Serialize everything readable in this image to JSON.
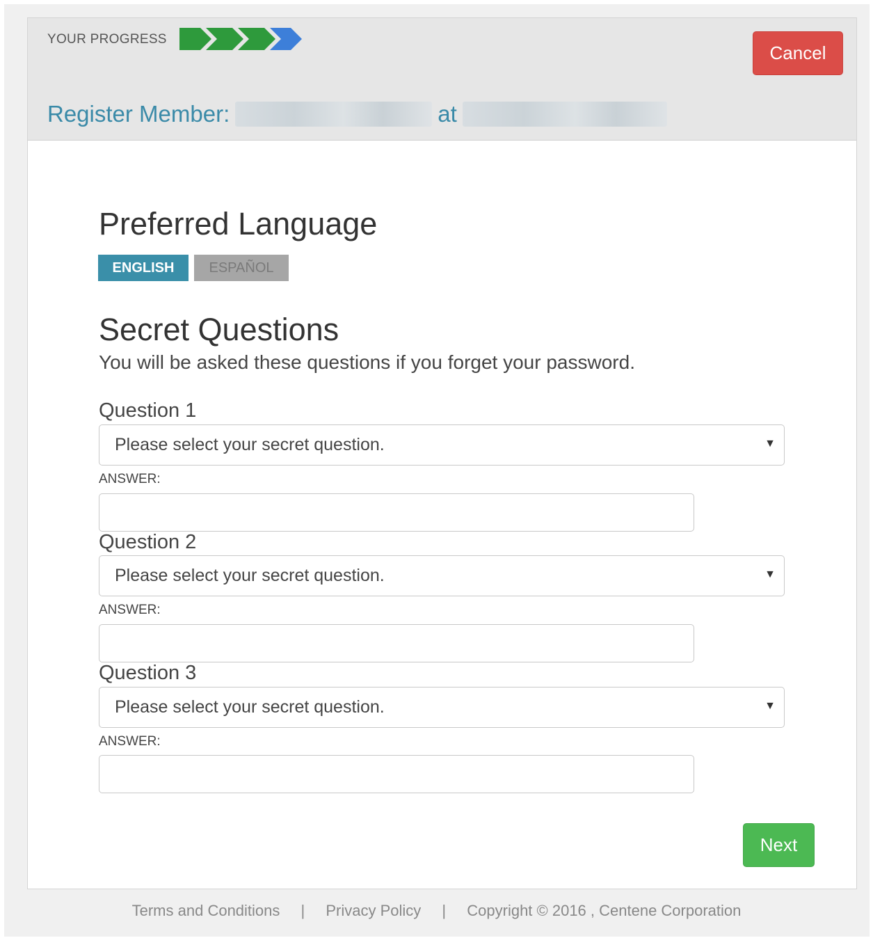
{
  "header": {
    "progress_label": "YOUR PROGRESS",
    "cancel_label": "Cancel",
    "register_label": "Register Member:",
    "at_label": "at",
    "chevron_colors": [
      "#2e9a3c",
      "#2e9a3c",
      "#2e9a3c",
      "#3d7fd9"
    ]
  },
  "language": {
    "heading": "Preferred Language",
    "english_label": "ENGLISH",
    "spanish_label": "ESPAÑOL",
    "selected": "ENGLISH"
  },
  "secret": {
    "heading": "Secret Questions",
    "subtitle": "You will be asked these questions if you forget your password.",
    "questions": [
      {
        "label": "Question 1",
        "placeholder": "Please select your secret question.",
        "answer_label": "ANSWER:",
        "answer_value": ""
      },
      {
        "label": "Question 2",
        "placeholder": "Please select your secret question.",
        "answer_label": "ANSWER:",
        "answer_value": ""
      },
      {
        "label": "Question 3",
        "placeholder": "Please select your secret question.",
        "answer_label": "ANSWER:",
        "answer_value": ""
      }
    ]
  },
  "next_label": "Next",
  "footer": {
    "terms": "Terms and Conditions",
    "separator": "|",
    "privacy": "Privacy Policy",
    "copyright": "Copyright © 2016 , Centene Corporation"
  },
  "colors": {
    "accent": "#3a8fa9",
    "cancel": "#db4d48",
    "next": "#4cb953"
  },
  "icons": {
    "progress": "chevron-right-icon",
    "dropdown": "caret-down-icon"
  }
}
